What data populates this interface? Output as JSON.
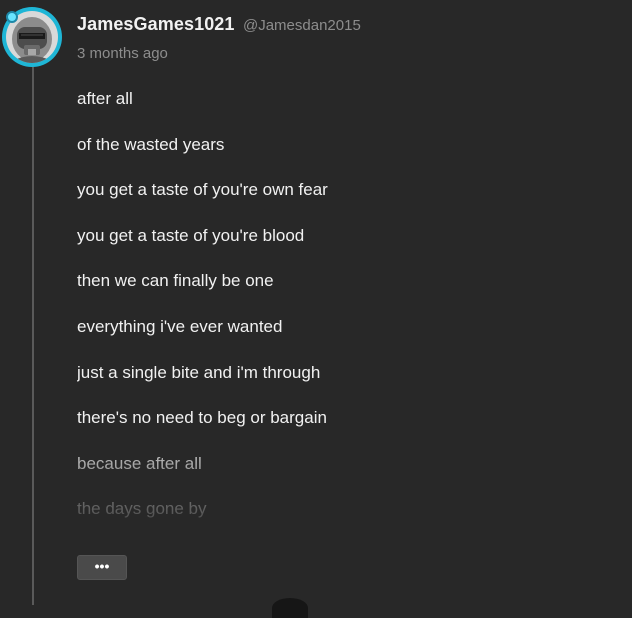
{
  "comment": {
    "display_name": "JamesGames1021",
    "username": "@Jamesdan2015",
    "timestamp": "3 months ago",
    "lines": [
      "after all",
      "of the wasted years",
      "you get a taste of you're own fear",
      "you get a taste of you're blood",
      "then we can finally be one",
      "everything i've ever wanted",
      "just a single bite and i'm through",
      "there's no need to beg or bargain",
      "because after all",
      "the days gone by"
    ],
    "expand_label": "•••"
  },
  "icons": {
    "avatar": "robot-avatar-icon",
    "badge": "badge-icon"
  },
  "colors": {
    "background": "#282828",
    "avatar_ring": "#1fb6d6",
    "text": "#f1f1f1",
    "muted_text": "#8d8d8d",
    "button": "#4a4a4a"
  }
}
